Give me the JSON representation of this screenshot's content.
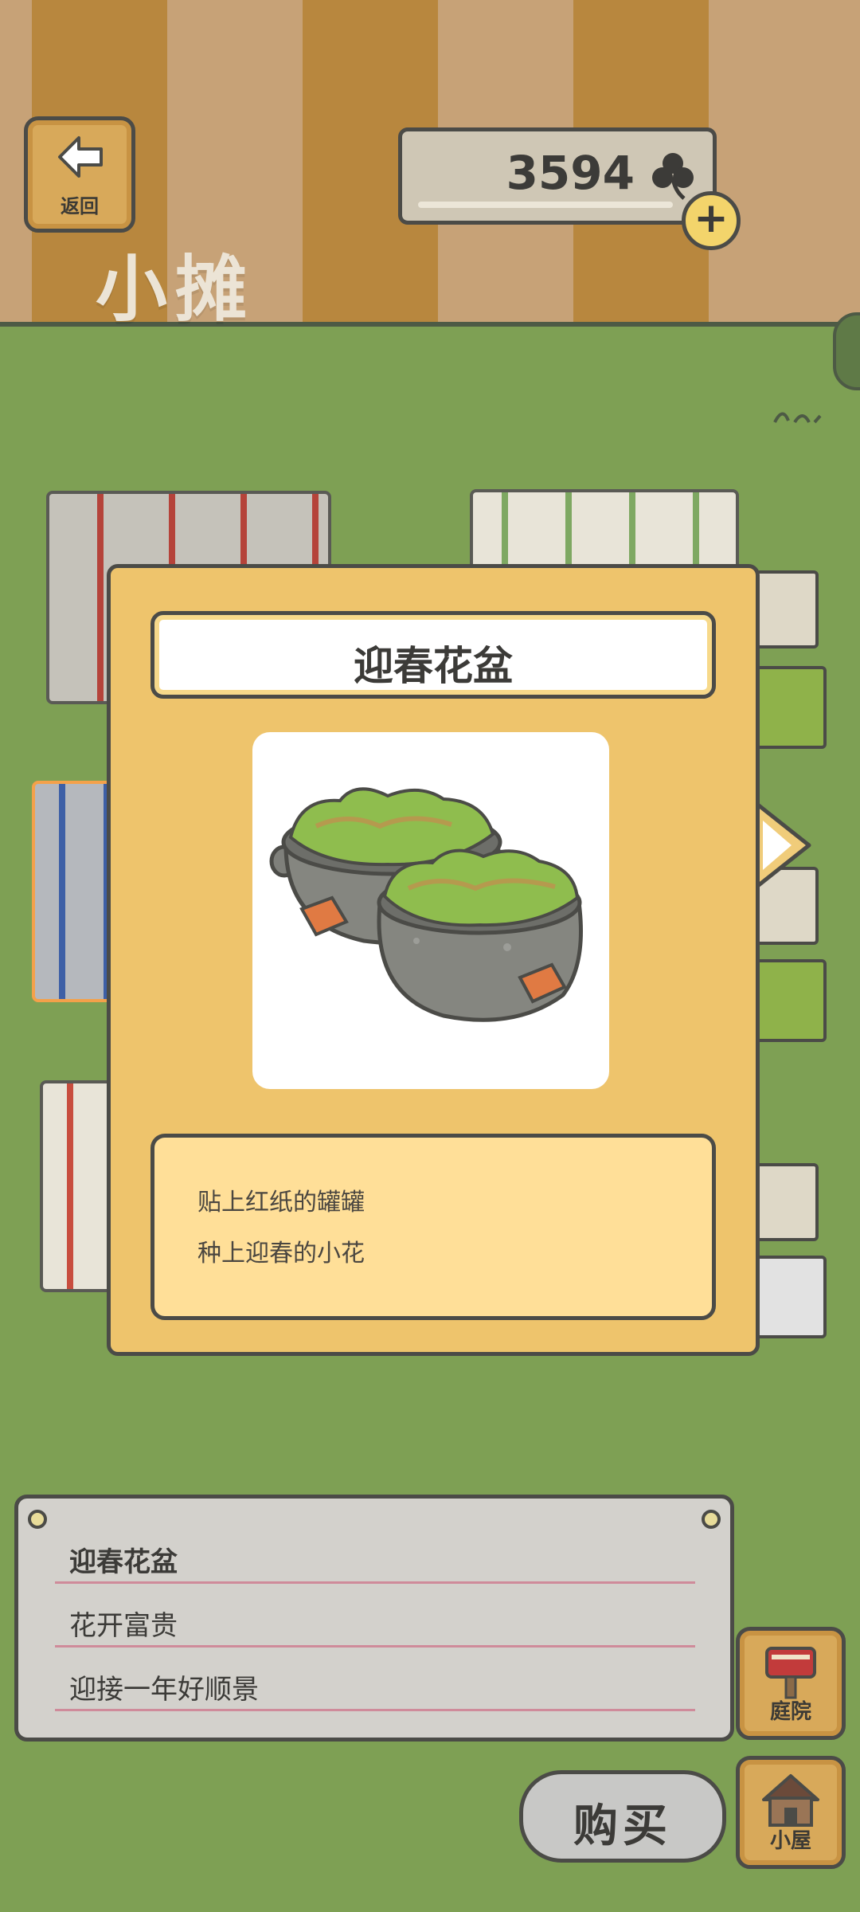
{
  "header": {
    "back_label": "返回",
    "shop_title": "小摊",
    "clover_count": "3594",
    "clover_icon": "clover-icon",
    "add_icon": "plus-icon",
    "add_symbol": "+"
  },
  "dialog": {
    "title": "迎春花盆",
    "image_icon": "flower-pot-pair",
    "description": [
      "贴上红纸的罐罐",
      "种上迎春的小花"
    ]
  },
  "info_card": {
    "lines": [
      "迎春花盆",
      "花开富贵",
      "迎接一年好顺景"
    ]
  },
  "nav": {
    "yard_label": "庭院",
    "yard_icon": "mailbox-icon",
    "house_label": "小屋",
    "house_icon": "house-icon"
  },
  "buy": {
    "label": "购买"
  },
  "colors": {
    "grass": "#7ea054",
    "dialog_bg": "#eec46c",
    "desc_bg": "#ffdf98",
    "outline": "#4b4b47",
    "wood": "#d8a95a"
  }
}
